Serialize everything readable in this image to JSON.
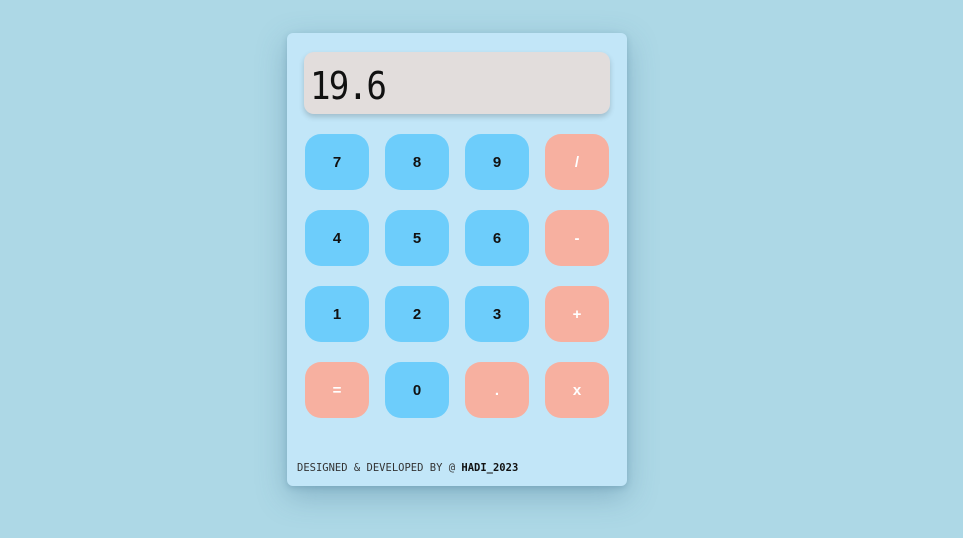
{
  "display": {
    "value": "19.6"
  },
  "keys": [
    {
      "label": "7",
      "type": "num"
    },
    {
      "label": "8",
      "type": "num"
    },
    {
      "label": "9",
      "type": "num"
    },
    {
      "label": "/",
      "type": "op"
    },
    {
      "label": "4",
      "type": "num"
    },
    {
      "label": "5",
      "type": "num"
    },
    {
      "label": "6",
      "type": "num"
    },
    {
      "label": "-",
      "type": "op"
    },
    {
      "label": "1",
      "type": "num"
    },
    {
      "label": "2",
      "type": "num"
    },
    {
      "label": "3",
      "type": "num"
    },
    {
      "label": "+",
      "type": "op"
    },
    {
      "label": "=",
      "type": "op"
    },
    {
      "label": "0",
      "type": "num"
    },
    {
      "label": ".",
      "type": "op"
    },
    {
      "label": "x",
      "type": "op"
    }
  ],
  "footer": {
    "text": "DESIGNED & DEVELOPED BY @ ",
    "handle": "HADI_2023"
  },
  "colors": {
    "background": "#add8e6",
    "panel": "#c2e6f8",
    "display": "#e2dddc",
    "number_key": "#6dcdfb",
    "operator_key": "#f7b0a0"
  }
}
